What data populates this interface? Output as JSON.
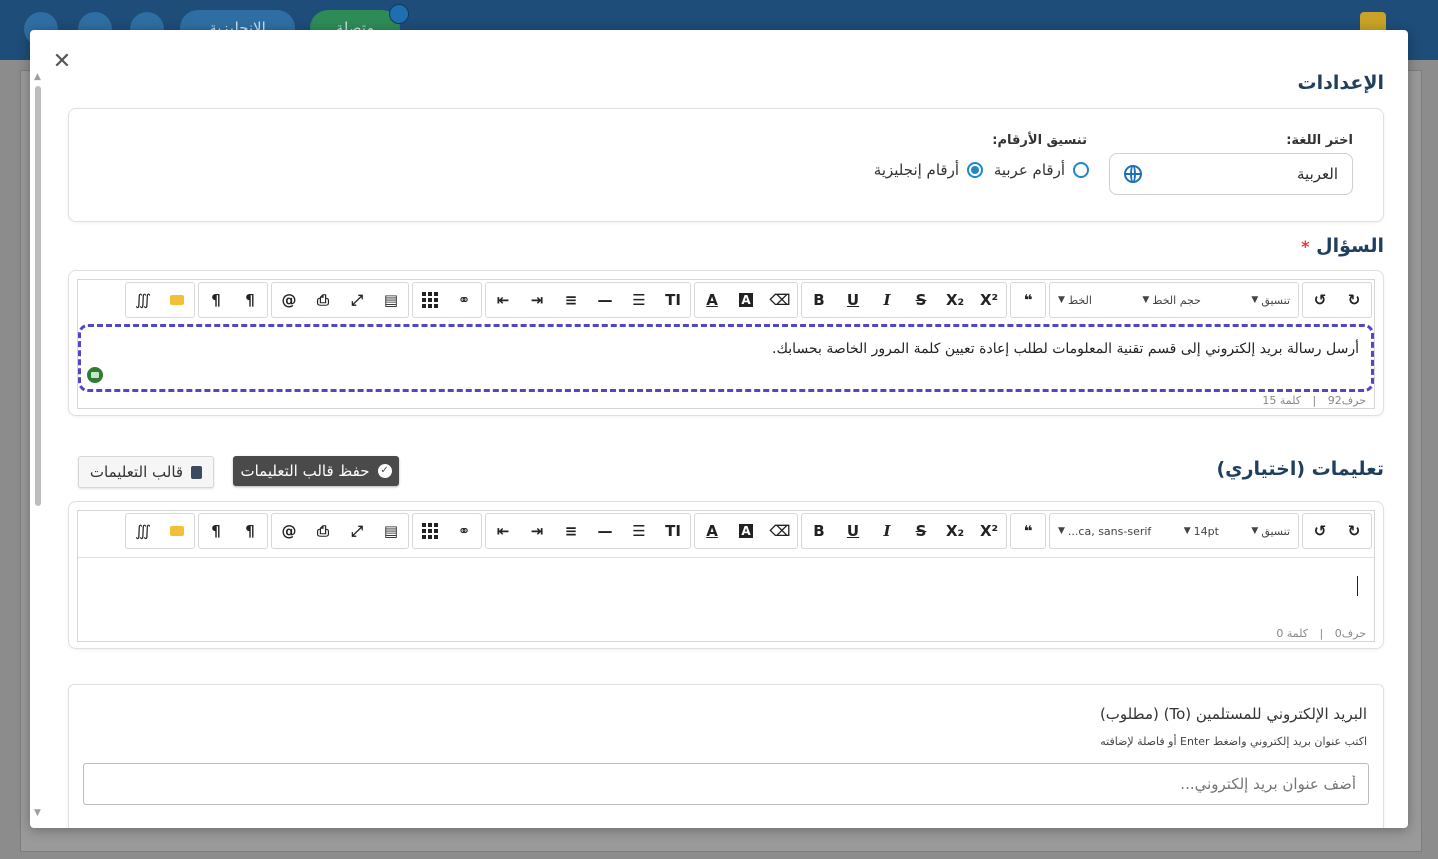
{
  "topbar": {
    "lang_pill": "الإنجليزية",
    "status_pill": "متصلة"
  },
  "modal": {
    "settings_title": "الإعدادات",
    "language": {
      "label": "اختر اللغة:",
      "value": "العربية"
    },
    "numbers": {
      "label": "تنسيق الأرقام:",
      "option_arabic": "أرقام عربية",
      "option_english": "أرقام إنجليزية",
      "selected": "english"
    },
    "question": {
      "title": "السؤال",
      "required_mark": "*",
      "content": "أرسل رسالة بريد إلكتروني إلى قسم تقنية المعلومات لطلب إعادة تعيين كلمة المرور الخاصة بحسابك.",
      "status_chars": "حرف92",
      "status_words": "كلمة 15",
      "status_sep": "|",
      "format_select": "تنسيق",
      "font_size_select": "حجم الخط",
      "font_select": "الخط"
    },
    "instructions": {
      "title": "تعليمات (اختياري)",
      "save_template_button": "حفظ قالب التعليمات",
      "template_button": "قالب التعليمات",
      "status_chars": "حرف0",
      "status_words": "كلمة 0",
      "status_sep": "|",
      "format_select": "تنسيق",
      "font_size_select": "14pt",
      "font_select": "...ca, sans-serif"
    },
    "recipients": {
      "title": "البريد الإلكتروني للمستلمين (To) (مطلوب)",
      "hint": "اكتب عنوان بريد إلكتروني واضغط Enter أو فاصلة لإضافته",
      "placeholder": "أضف عنوان بريد إلكتروني..."
    }
  },
  "toolbar_icons": [
    "redo-icon",
    "undo-icon",
    "format-select",
    "font-size-select",
    "font-select",
    "blockquote-icon",
    "superscript-icon",
    "subscript-icon",
    "strikethrough-icon",
    "italic-icon",
    "underline-icon",
    "bold-icon",
    "clear-format-icon",
    "bg-color-icon",
    "text-color-icon",
    "text-size-icon",
    "ordered-list-icon",
    "horizontal-rule-icon",
    "align-icon",
    "indent-icon",
    "outdent-icon",
    "link-icon",
    "table-icon",
    "template-icon",
    "fullscreen-icon",
    "print-icon",
    "mention-icon",
    "ltr-icon",
    "rtl-icon",
    "folder-icon",
    "special-chars-icon"
  ]
}
